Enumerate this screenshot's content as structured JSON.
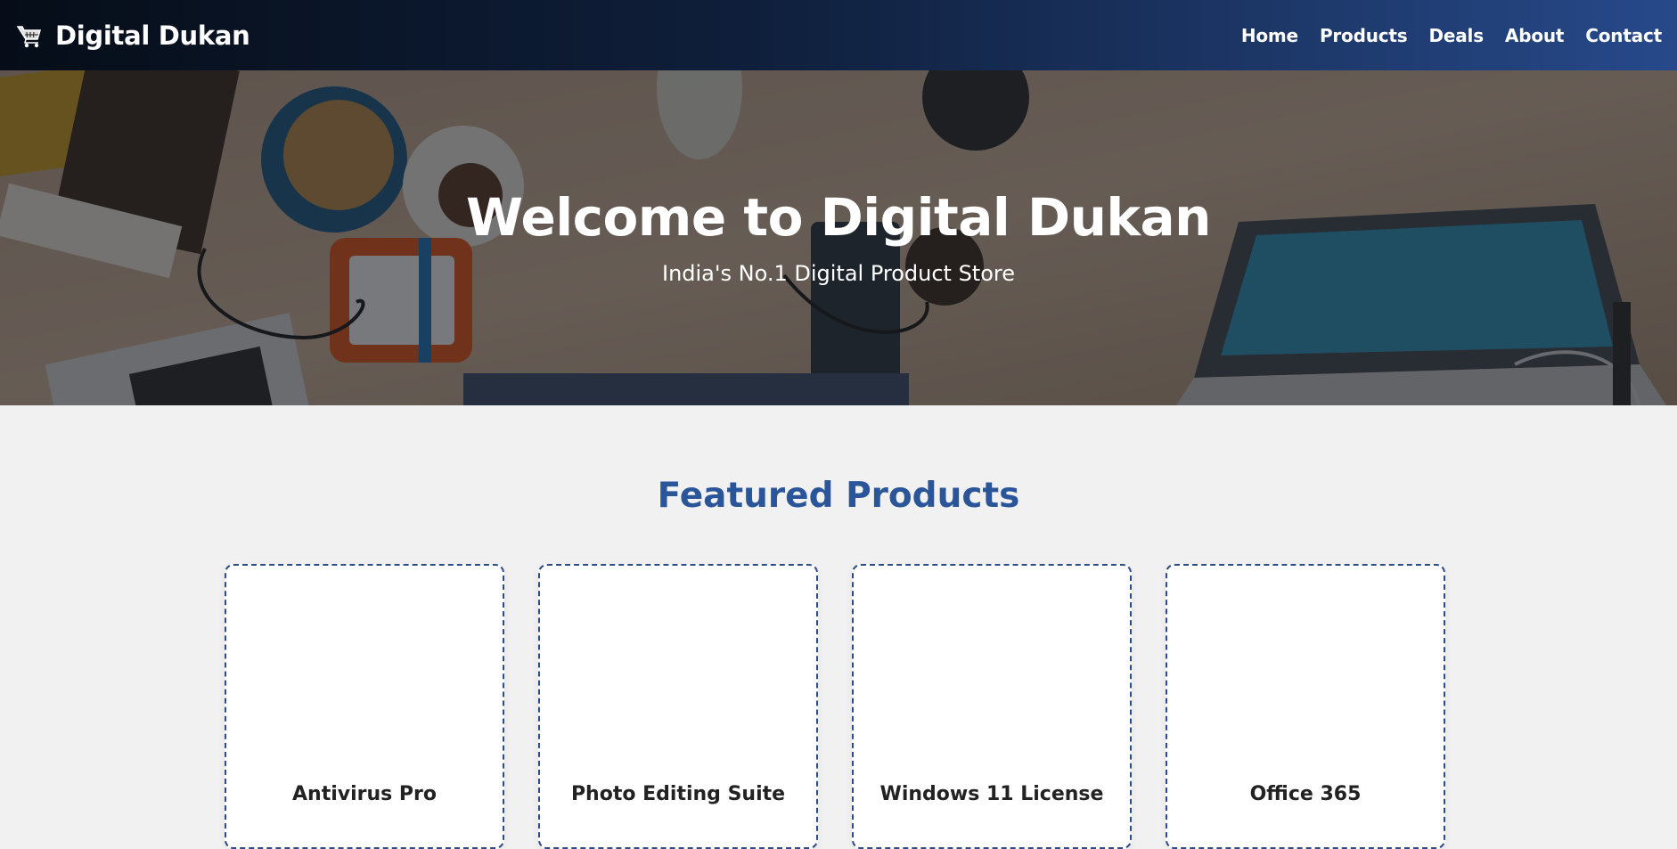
{
  "header": {
    "brand_icon": "shopping-cart-icon",
    "brand_name": "Digital Dukan",
    "nav": [
      "Home",
      "Products",
      "Deals",
      "About",
      "Contact"
    ]
  },
  "hero": {
    "title": "Welcome to Digital Dukan",
    "subtitle": "India's No.1 Digital Product Store"
  },
  "featured": {
    "title": "Featured Products",
    "products": [
      "Antivirus Pro",
      "Photo Editing Suite",
      "Windows 11 License",
      "Office 365"
    ]
  },
  "colors": {
    "header_gradient_start": "#060d18",
    "header_gradient_end": "#27498a",
    "section_title": "#2b5599",
    "card_border": "#2b4c86",
    "page_background": "#f1f1f1"
  }
}
